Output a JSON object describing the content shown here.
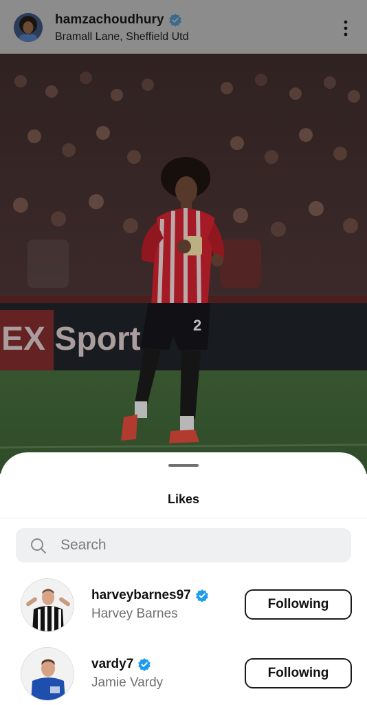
{
  "post": {
    "username": "hamzachoudhury",
    "location": "Bramall Lane, Sheffield Utd",
    "photo_ad_text": "EX Sport",
    "player_number": "2"
  },
  "likes_sheet": {
    "title": "Likes",
    "search": {
      "placeholder": "Search",
      "value": ""
    },
    "users": [
      {
        "username": "harveybarnes97",
        "full_name": "Harvey Barnes",
        "verified": true,
        "button": "Following"
      },
      {
        "username": "vardy7",
        "full_name": "Jamie Vardy",
        "verified": true,
        "button": "Following"
      }
    ]
  },
  "colors": {
    "verified_blue": "#1d9bf0",
    "header_overlay": "#8c8c8c",
    "kit_red": "#c8202e"
  },
  "icons": {
    "verified": "verified-badge-icon",
    "more": "more-vertical-icon",
    "search": "search-icon"
  }
}
